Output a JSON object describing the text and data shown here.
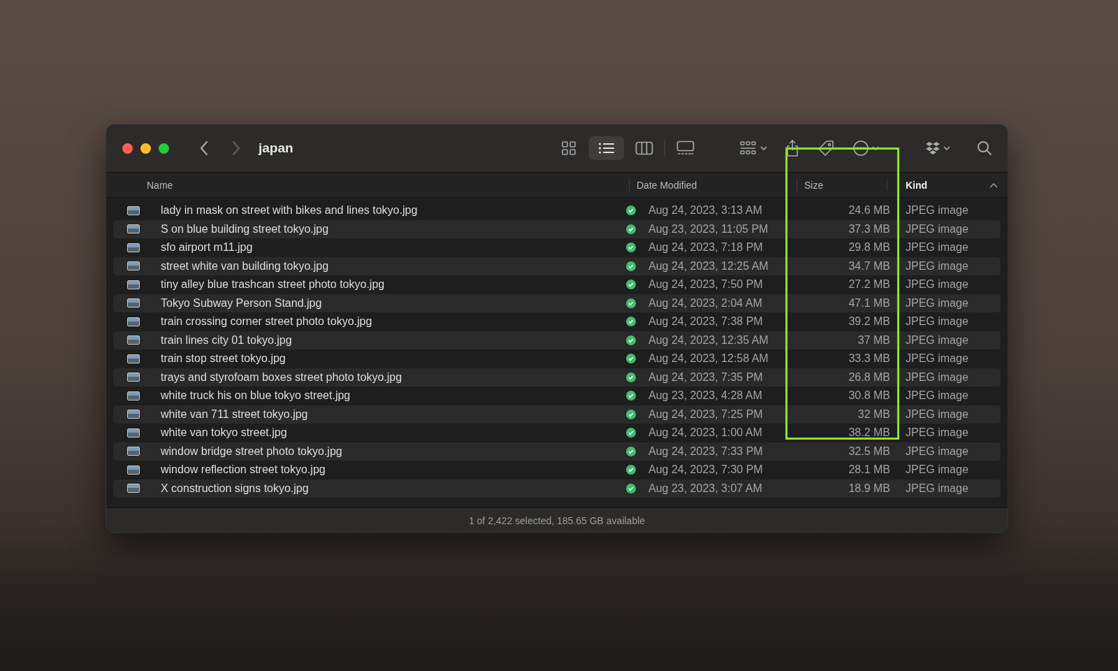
{
  "window": {
    "title": "japan"
  },
  "navigation": [
    {
      "kind": "back",
      "disabled": false
    },
    {
      "kind": "forward",
      "disabled": true
    }
  ],
  "view_modes": [
    {
      "kind": "icons",
      "selected": false
    },
    {
      "kind": "list",
      "selected": true
    },
    {
      "kind": "columns",
      "selected": false
    },
    {
      "kind": "gallery",
      "selected": false
    }
  ],
  "columns": [
    {
      "label": "Name",
      "sorted": false
    },
    {
      "label": "Date Modified",
      "sorted": false
    },
    {
      "label": "Size",
      "sorted": false
    },
    {
      "label": "Kind",
      "sorted": true
    }
  ],
  "rows": [
    {
      "name": "lady in mask on street with bikes and lines tokyo.jpg",
      "synced": true,
      "date": "Aug 24, 2023, 3:13 AM",
      "size": "24.6 MB",
      "kind": "JPEG image"
    },
    {
      "name": "S on blue building street tokyo.jpg",
      "synced": true,
      "date": "Aug 23, 2023, 11:05 PM",
      "size": "37.3 MB",
      "kind": "JPEG image"
    },
    {
      "name": "sfo airport m11.jpg",
      "synced": true,
      "date": "Aug 24, 2023, 7:18 PM",
      "size": "29.8 MB",
      "kind": "JPEG image"
    },
    {
      "name": "street white van building tokyo.jpg",
      "synced": true,
      "date": "Aug 24, 2023, 12:25 AM",
      "size": "34.7 MB",
      "kind": "JPEG image"
    },
    {
      "name": "tiny alley blue trashcan street photo tokyo.jpg",
      "synced": true,
      "date": "Aug 24, 2023, 7:50 PM",
      "size": "27.2 MB",
      "kind": "JPEG image"
    },
    {
      "name": "Tokyo Subway Person Stand.jpg",
      "synced": true,
      "date": "Aug 24, 2023, 2:04 AM",
      "size": "47.1 MB",
      "kind": "JPEG image"
    },
    {
      "name": "train crossing corner street photo tokyo.jpg",
      "synced": true,
      "date": "Aug 24, 2023, 7:38 PM",
      "size": "39.2 MB",
      "kind": "JPEG image"
    },
    {
      "name": "train lines city 01 tokyo.jpg",
      "synced": true,
      "date": "Aug 24, 2023, 12:35 AM",
      "size": "37 MB",
      "kind": "JPEG image"
    },
    {
      "name": "train stop street tokyo.jpg",
      "synced": true,
      "date": "Aug 24, 2023, 12:58 AM",
      "size": "33.3 MB",
      "kind": "JPEG image"
    },
    {
      "name": "trays and styrofoam boxes street photo tokyo.jpg",
      "synced": true,
      "date": "Aug 24, 2023, 7:35 PM",
      "size": "26.8 MB",
      "kind": "JPEG image"
    },
    {
      "name": "white truck his on blue tokyo street.jpg",
      "synced": true,
      "date": "Aug 23, 2023, 4:28 AM",
      "size": "30.8 MB",
      "kind": "JPEG image"
    },
    {
      "name": "white van 711 street tokyo.jpg",
      "synced": true,
      "date": "Aug 24, 2023, 7:25 PM",
      "size": "32 MB",
      "kind": "JPEG image"
    },
    {
      "name": "white van tokyo street.jpg",
      "synced": true,
      "date": "Aug 24, 2023, 1:00 AM",
      "size": "38.2 MB",
      "kind": "JPEG image"
    },
    {
      "name": "window bridge street photo tokyo.jpg",
      "synced": true,
      "date": "Aug 24, 2023, 7:33 PM",
      "size": "32.5 MB",
      "kind": "JPEG image"
    },
    {
      "name": "window reflection street tokyo.jpg",
      "synced": true,
      "date": "Aug 24, 2023, 7:30 PM",
      "size": "28.1 MB",
      "kind": "JPEG image"
    },
    {
      "name": "X construction signs tokyo.jpg",
      "synced": true,
      "date": "Aug 23, 2023, 3:07 AM",
      "size": "18.9 MB",
      "kind": "JPEG image"
    }
  ],
  "status_bar": "1 of 2,422 selected, 185.65 GB available"
}
